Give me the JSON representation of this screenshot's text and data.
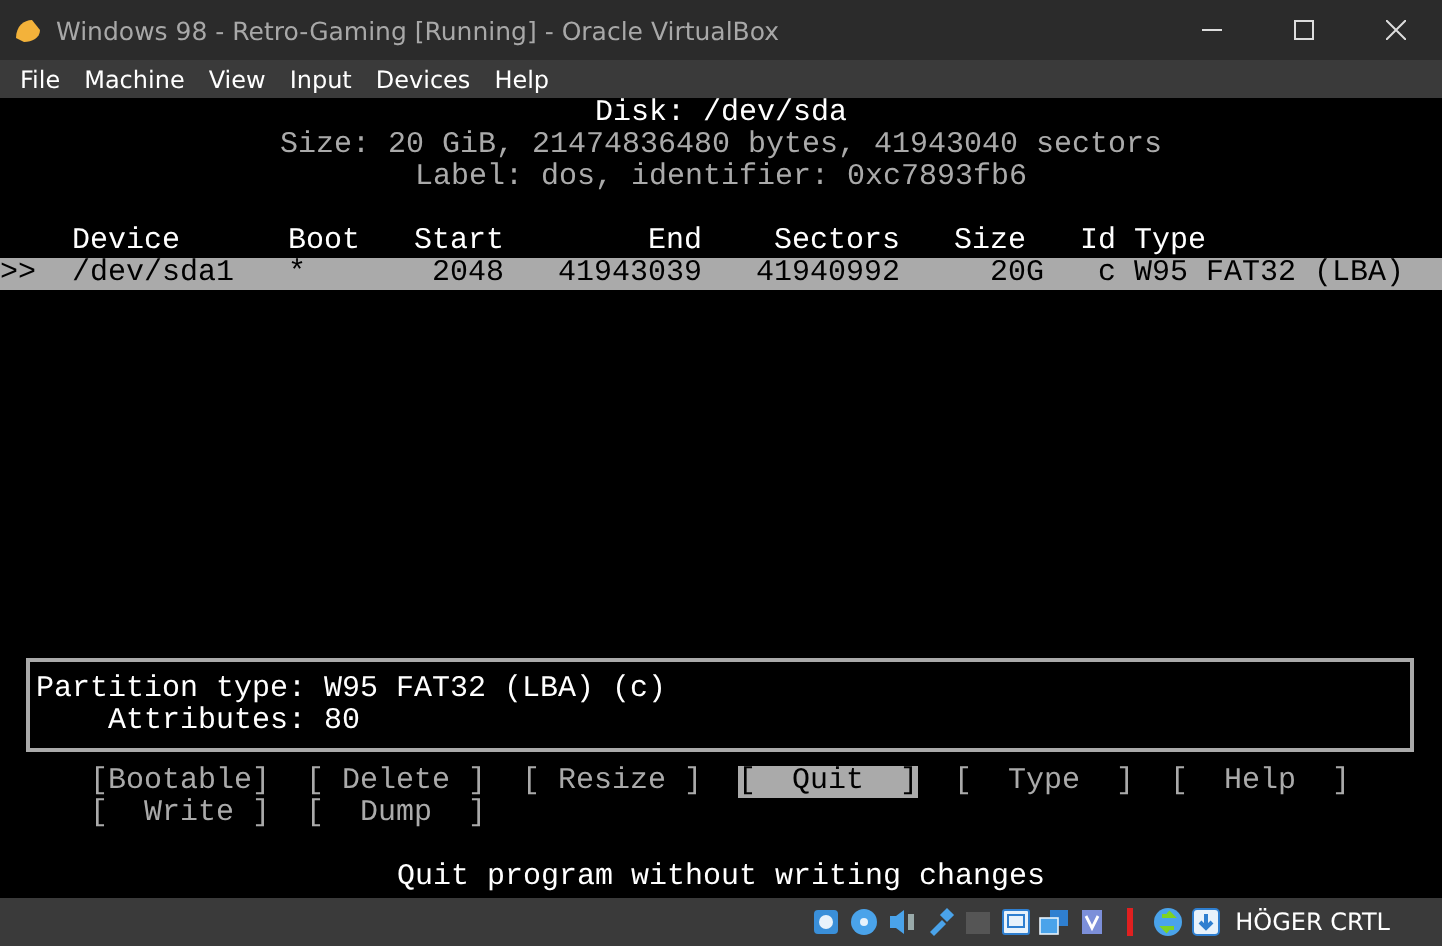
{
  "window": {
    "title": "Windows 98 - Retro-Gaming [Running] - Oracle VirtualBox"
  },
  "menu": [
    "File",
    "Machine",
    "View",
    "Input",
    "Devices",
    "Help"
  ],
  "header": [
    "Disk: /dev/sda",
    "Size: 20 GiB, 21474836480 bytes, 41943040 sectors",
    "Label: dos, identifier: 0xc7893fb6"
  ],
  "table": {
    "columns": [
      "Device",
      "Boot",
      "Start",
      "End",
      "Sectors",
      "Size",
      "Id",
      "Type"
    ],
    "rows": [
      {
        "selected": true,
        "marker": ">>",
        "cells": [
          "/dev/sda1",
          "*",
          "2048",
          "41943039",
          "41940992",
          "20G",
          "c",
          "W95 FAT32 (LBA)"
        ]
      }
    ]
  },
  "info": [
    "Partition type: W95 FAT32 (LBA) (c)",
    "    Attributes: 80"
  ],
  "actions": [
    {
      "label": "[Bootable]",
      "selected": false
    },
    {
      "label": "[ Delete ]",
      "selected": false
    },
    {
      "label": "[ Resize ]",
      "selected": false
    },
    {
      "label": "[  Quit  ]",
      "selected": true
    },
    {
      "label": "[  Type  ]",
      "selected": false
    },
    {
      "label": "[  Help  ]",
      "selected": false
    },
    {
      "label": "[  Write ]",
      "selected": false
    },
    {
      "label": "[  Dump  ]",
      "selected": false
    }
  ],
  "hint": "Quit program without writing changes",
  "status_bar": {
    "host_key": "HÖGER CRTL"
  }
}
